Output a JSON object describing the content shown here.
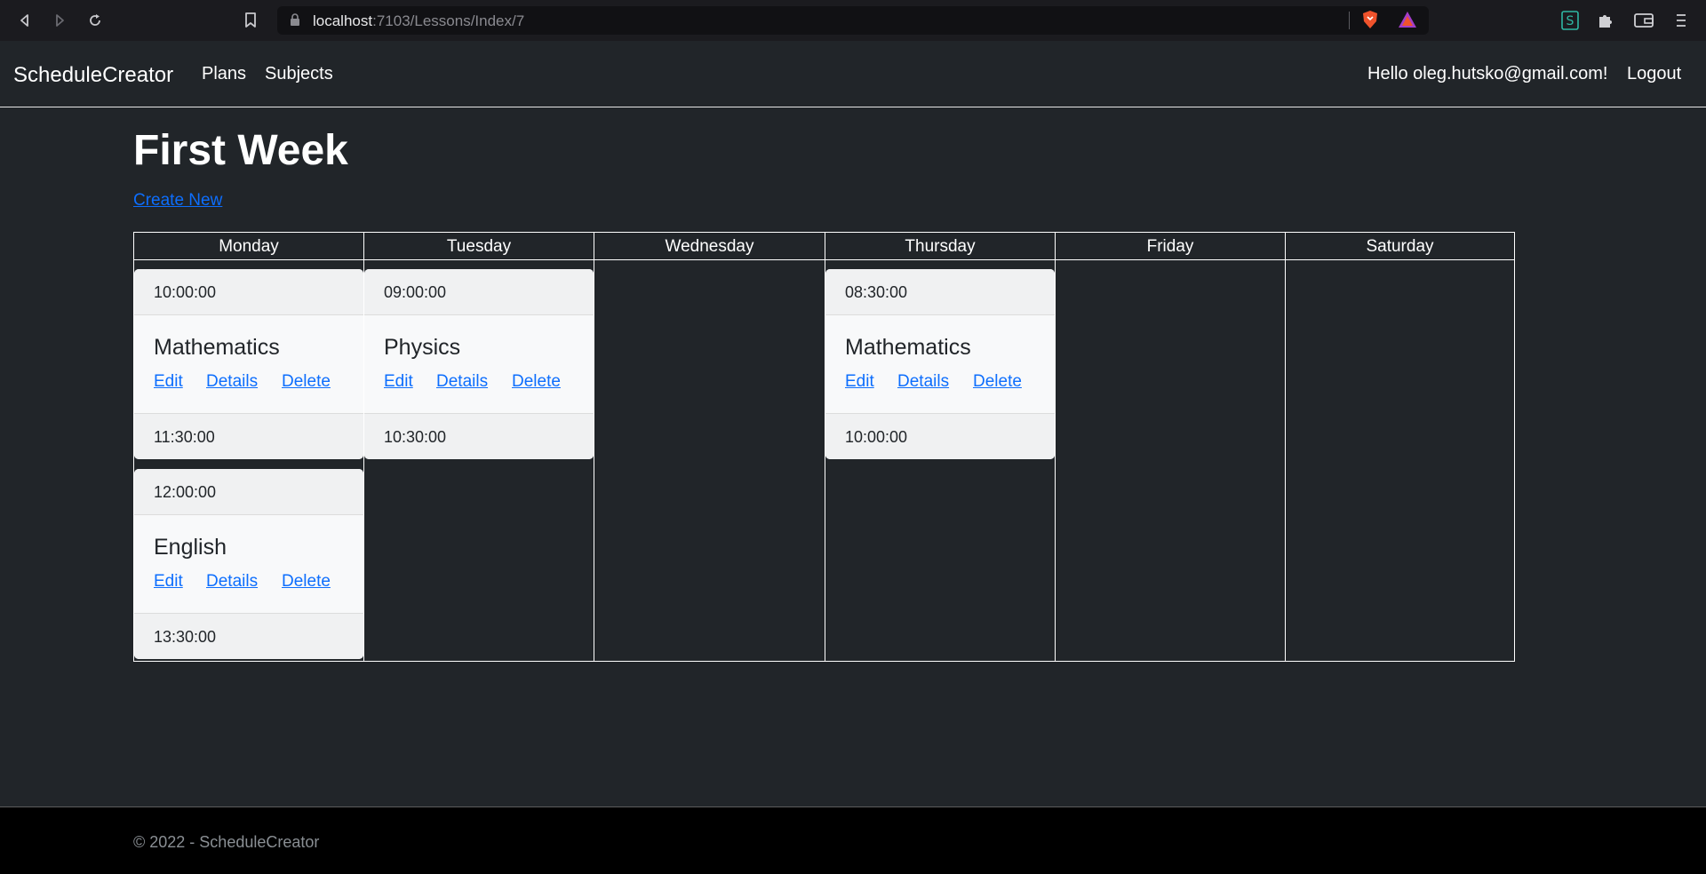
{
  "browser": {
    "url_host": "localhost",
    "url_path": ":7103/Lessons/Index/7",
    "icons": [
      "back-icon",
      "forward-icon",
      "reload-icon",
      "bookmark-icon",
      "lock-icon",
      "brave-shield-icon",
      "brave-rewards-icon",
      "s-extension-icon",
      "puzzle-icon",
      "wallet-icon",
      "menu-icon"
    ]
  },
  "navbar": {
    "brand": "ScheduleCreator",
    "links": [
      "Plans",
      "Subjects"
    ],
    "greeting": "Hello oleg.hutsko@gmail.com!",
    "logout": "Logout"
  },
  "main": {
    "title": "First Week",
    "create_new": "Create New"
  },
  "schedule": {
    "days": [
      "Monday",
      "Tuesday",
      "Wednesday",
      "Thursday",
      "Friday",
      "Saturday"
    ],
    "action_labels": {
      "edit": "Edit",
      "details": "Details",
      "delete": "Delete"
    },
    "lessons": [
      {
        "day": "Monday",
        "start": "10:00:00",
        "subject": "Mathematics",
        "end": "11:30:00"
      },
      {
        "day": "Monday",
        "start": "12:00:00",
        "subject": "English",
        "end": "13:30:00"
      },
      {
        "day": "Tuesday",
        "start": "09:00:00",
        "subject": "Physics",
        "end": "10:30:00"
      },
      {
        "day": "Thursday",
        "start": "08:30:00",
        "subject": "Mathematics",
        "end": "10:00:00"
      }
    ]
  },
  "footer": {
    "text": "© 2022 - ScheduleCreator"
  },
  "colors": {
    "page_bg": "#212529",
    "link": "#0d6efd",
    "card_bg": "#f8f9fa",
    "footer_bg": "#000000"
  }
}
